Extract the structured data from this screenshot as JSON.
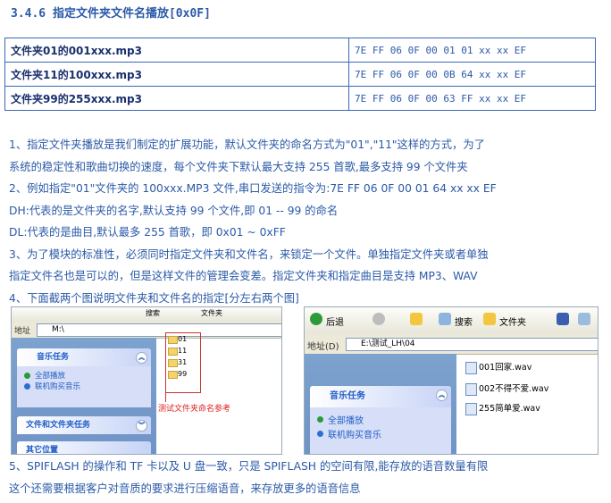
{
  "section_title": "3.4.6 指定文件夹文件名播放[0x0F]",
  "commands": [
    {
      "name": "文件夹01的001xxx.mp3",
      "bytes": "7E  FF  06  0F  00  01  01  xx  xx  EF"
    },
    {
      "name": "文件夹11的100xxx.mp3",
      "bytes": "7E  FF  06  0F  00  0B  64  xx  xx  EF"
    },
    {
      "name": "文件夹99的255xxx.mp3",
      "bytes": "7E  FF  06  0F  00  63  FF  xx  xx  EF"
    }
  ],
  "notes": [
    "1、指定文件夹播放是我们制定的扩展功能，默认文件夹的命名方式为\"01\",\"11\"这样的方式，为了",
    "系统的稳定性和歌曲切换的速度，每个文件夹下默认最大支持 255 首歌,最多支持 99 个文件夹",
    "2、例如指定\"01\"文件夹的 100xxx.MP3 文件,串口发送的指令为:7E FF 06 0F 00 01 64 xx xx EF",
    "DH:代表的是文件夹的名字,默认支持 99 个文件,即 01 -- 99 的命名",
    "DL:代表的是曲目,默认最多 255 首歌，即 0x01 ~ 0xFF",
    "3、为了模块的标准性，必须同时指定文件夹和文件名，来锁定一个文件。单独指定文件夹或者单独",
    "指定文件名也是可以的，但是这样文件的管理会变差。指定文件夹和指定曲目是支持 MP3、WAV",
    "4、下面截两个图说明文件夹和文件名的指定[分左右两个图]"
  ],
  "left_shot": {
    "address_label": "地址",
    "address_value": "M:\\",
    "panel_music": "音乐任务",
    "music_items": [
      "全部播放",
      "联机购买音乐"
    ],
    "panel_files": "文件和文件夹任务",
    "panel_other": "其它位置",
    "folders": [
      "01",
      "11",
      "31",
      "99"
    ],
    "annotation": "测试文件夹命名参考",
    "toolbar_search": "搜索",
    "toolbar_folder": "文件夹"
  },
  "right_shot": {
    "back_label": "后退",
    "toolbar_search": "搜索",
    "toolbar_folder": "文件夹",
    "address_label": "地址(D)",
    "address_value": "E:\\测试_LH\\04",
    "panel_music": "音乐任务",
    "music_items": [
      "全部播放",
      "联机购买音乐"
    ],
    "files": [
      "001回家.wav",
      "002不得不爱.wav",
      "255简单爱.wav"
    ]
  },
  "notes_bottom": [
    "5、SPIFLASH 的操作和 TF 卡以及 U 盘一致，只是 SPIFLASH 的空间有限,能存放的语音数量有限",
    "这个还需要根据客户对音质的要求进行压缩语音，来存放更多的语音信息"
  ]
}
